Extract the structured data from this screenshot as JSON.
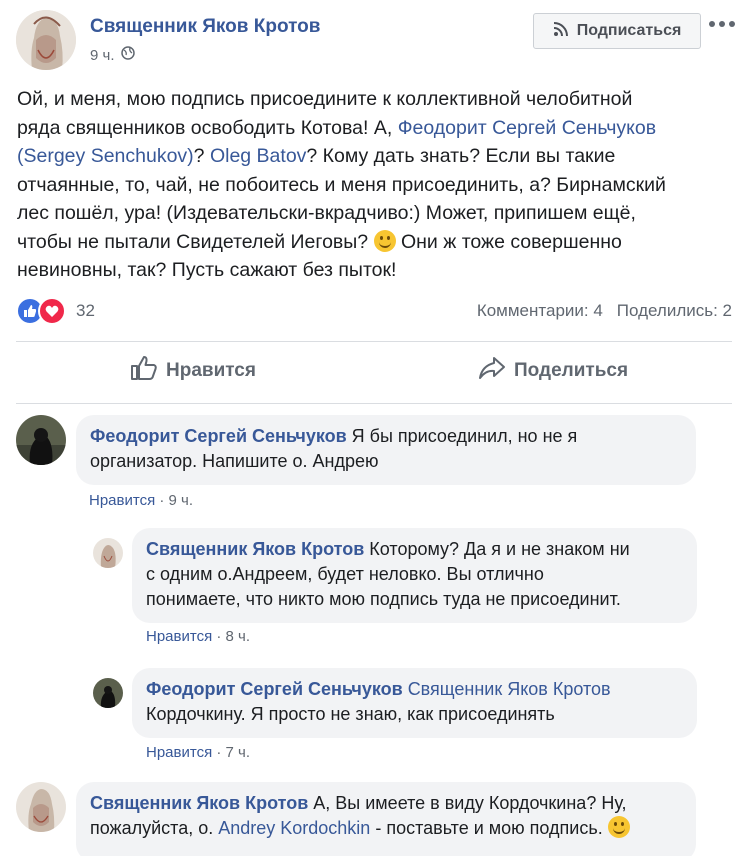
{
  "post": {
    "author": "Священник Яков Кротов",
    "time": "9 ч.",
    "subscribe_label": "Подписаться",
    "text": {
      "l1": "Ой, и меня, мою подпись присоедините к коллективной челобитной",
      "l2_a": "ряда священников освободить Котова! А, ",
      "l2_link": "Феодорит Сергей Сеньчуков",
      "l3_link": "(Sergey Senchukov)",
      "l3_b": "? ",
      "l3_link2": "Oleg Batov",
      "l3_c": "? Кому дать знать? Если вы такие",
      "l4": "отчаянные, то, чай, не побоитесь и меня присоединить, а? Бирнамский",
      "l5": "лес пошёл, ура! (Издевательски-вкрадчиво:) Может, припишем ещё,",
      "l6_a": "чтобы не пытали Свидетелей Иеговы? ",
      "l6_b": " Они ж тоже совершенно",
      "l7": "невиновны, так? Пусть сажают без пыток!"
    },
    "reaction_count": "32",
    "comments_count": "Комментарии: 4",
    "shares_count": "Поделились: 2",
    "like_label": "Нравится",
    "share_label": "Поделиться"
  },
  "comments": [
    {
      "author": "Феодорит Сергей Сеньчуков",
      "text_l1": " Я бы присоединил, но не я",
      "text_l2": "организатор. Напишите о. Андрею",
      "like": "Нравится",
      "time": "· 9 ч."
    },
    {
      "author": "Священник Яков Кротов",
      "text_l1": " Которому? Да я и не знаком ни",
      "text_l2": "с одним о.Андреем, будет неловко. Вы отлично",
      "text_l3": "понимаете, что никто мою подпись туда не присоединит.",
      "like": "Нравится",
      "time": "· 8 ч."
    },
    {
      "author": "Феодорит Сергей Сеньчуков",
      "mention": "Священник Яков Кротов",
      "text_l2": "Кордочкину. Я просто не знаю, как присоединять",
      "like": "Нравится",
      "time": "· 7 ч."
    },
    {
      "author": "Священник Яков Кротов",
      "text_l1": " А, Вы имеете в виду Кордочкина? Ну,",
      "text_l2a": "пожалуйста, о. ",
      "text_link": "Andrey Kordochkin",
      "text_l2b": " - поставьте и мою подпись. "
    }
  ],
  "icons": [
    "rss-icon",
    "globe-icon",
    "more-icon",
    "like-reaction-icon",
    "love-reaction-icon",
    "thumbs-up-icon",
    "share-arrow-icon",
    "smiley-emoji"
  ],
  "colors": {
    "link": "#385898",
    "meta": "#606770",
    "bubble": "#f2f3f5",
    "like": "#3b6fe0",
    "love": "#f0284a"
  }
}
